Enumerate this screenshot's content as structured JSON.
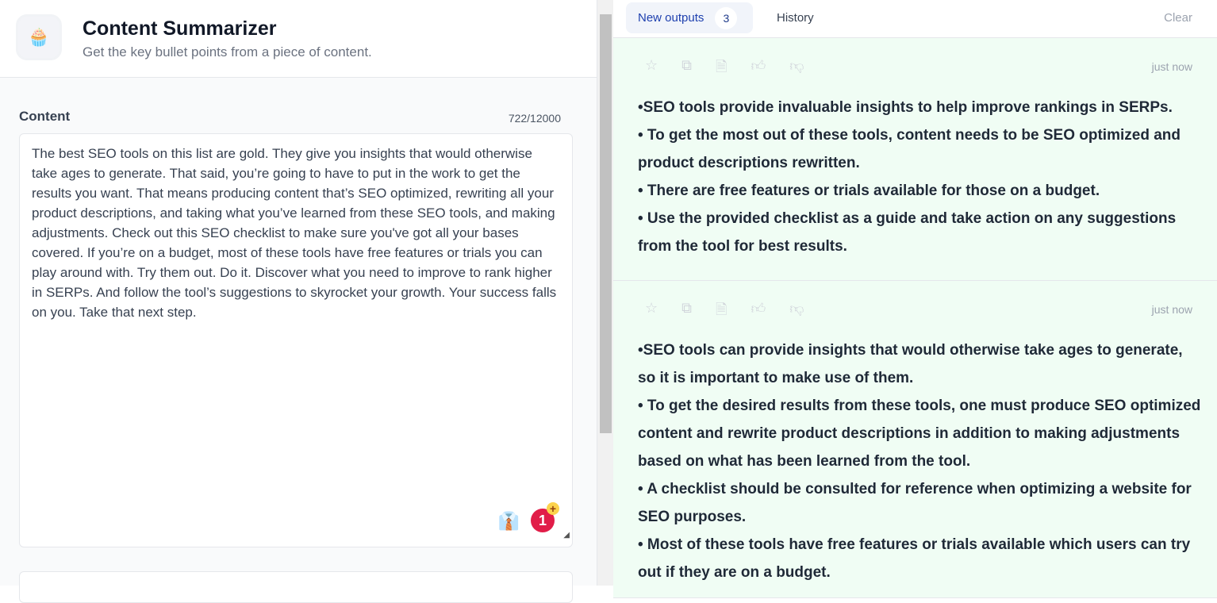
{
  "app": {
    "title": "Content Summarizer",
    "subtitle": "Get the key bullet points from a piece of content.",
    "logo_icon": "cupcake-icon"
  },
  "input": {
    "label": "Content",
    "count": "722/12000",
    "value": "The best SEO tools on this list are gold. They give you insights that would otherwise take ages to generate. That said, you’re going to have to put in the work to get the results you want. That means producing content that’s SEO optimized, rewriting all your product descriptions, and taking what you’ve learned from these SEO tools, and making adjustments. Check out this SEO checklist to make sure you've got all your bases covered. If you’re on a budget, most of these tools have free features or trials you can play around with. Try them out. Do it. Discover what you need to improve to rank higher in SERPs. And follow the tool’s suggestions to skyrocket your growth. Your success falls on you. Take that next step.",
    "badge_count": "1"
  },
  "tabs": {
    "new_outputs": "New outputs",
    "new_count": "3",
    "history": "History",
    "clear": "Clear"
  },
  "outputs": [
    {
      "time": "just now",
      "lines": [
        "•SEO tools provide invaluable insights to help improve rankings in SERPs.",
        "• To get the most out of these tools, content needs to be SEO optimized and product descriptions rewritten.",
        "• There are free features or trials available for those on a budget.",
        "• Use the provided checklist as a guide and take action on any suggestions from the tool for best results."
      ]
    },
    {
      "time": "just now",
      "lines": [
        "•SEO tools can provide insights that would otherwise take ages to generate, so it is important to make use of them.",
        "• To get the desired results from these tools, one must produce SEO optimized content and rewrite product descriptions in addition to making adjustments based on what has been learned from the tool.",
        "• A checklist should be consulted for reference when optimizing a website for SEO purposes.",
        "• Most of these tools have free features or trials available which users can try out if they are on a budget."
      ]
    }
  ]
}
